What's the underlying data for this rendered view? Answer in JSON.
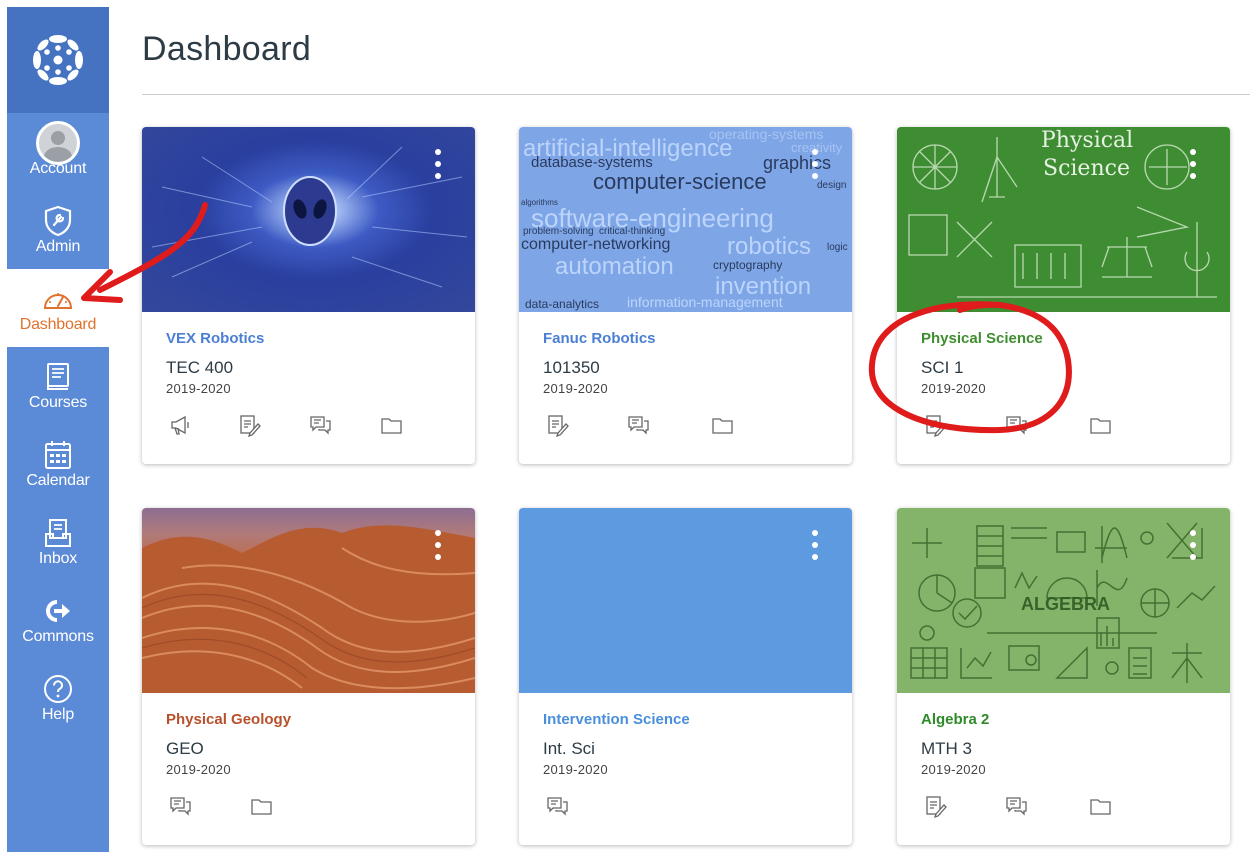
{
  "sidebar": {
    "items": [
      {
        "label": "Account",
        "icon": "account-avatar-icon"
      },
      {
        "label": "Admin",
        "icon": "shield-wrench-icon"
      },
      {
        "label": "Dashboard",
        "icon": "speedometer-icon",
        "active": true
      },
      {
        "label": "Courses",
        "icon": "book-icon"
      },
      {
        "label": "Calendar",
        "icon": "calendar-icon"
      },
      {
        "label": "Inbox",
        "icon": "inbox-icon"
      },
      {
        "label": "Commons",
        "icon": "commons-arrow-icon"
      },
      {
        "label": "Help",
        "icon": "help-question-icon"
      }
    ]
  },
  "page": {
    "title": "Dashboard"
  },
  "hero_words": {
    "fanuc": [
      "artificial-intelligence",
      "database-systems",
      "graphics",
      "computer-science",
      "software-engineering",
      "computer-networking",
      "robotics",
      "automation",
      "cryptography",
      "invention",
      "information-management",
      "data-analytics",
      "operating-systems",
      "creativity",
      "problem-solving",
      "critical-thinking",
      "logic",
      "design",
      "algorithms"
    ],
    "physical_title": [
      "Physical",
      "Science"
    ],
    "algebra": "ALGEBRA"
  },
  "cards": [
    {
      "name": "VEX Robotics",
      "code": "TEC 400",
      "term": "2019-2020",
      "color": "#4a7fd4",
      "actions": [
        "announcements-icon",
        "assignments-icon",
        "discussions-icon",
        "files-icon"
      ]
    },
    {
      "name": "Fanuc Robotics",
      "code": "101350",
      "term": "2019-2020",
      "color": "#4a7fd4",
      "actions": [
        "assignments-icon",
        "discussions-icon",
        "files-icon"
      ]
    },
    {
      "name": "Physical Science",
      "code": "SCI 1",
      "term": "2019-2020",
      "color": "#3f8e2f",
      "actions": [
        "assignments-icon",
        "discussions-icon",
        "files-icon"
      ]
    },
    {
      "name": "Physical Geology",
      "code": "GEO",
      "term": "2019-2020",
      "color": "#b8502b",
      "actions": [
        "discussions-icon",
        "files-icon"
      ]
    },
    {
      "name": "Intervention Science",
      "code": "Int. Sci",
      "term": "2019-2020",
      "color": "#4a8fdb",
      "actions": [
        "discussions-icon"
      ]
    },
    {
      "name": "Algebra 2",
      "code": "MTH 3",
      "term": "2019-2020",
      "color": "#2f8a2a",
      "actions": [
        "assignments-icon",
        "discussions-icon",
        "files-icon"
      ]
    }
  ],
  "colors": {
    "sidebar": "#5b8ad6",
    "sidebar_logo": "#4572c1",
    "active": "#e0722e",
    "annotation": "#e01b1b"
  }
}
